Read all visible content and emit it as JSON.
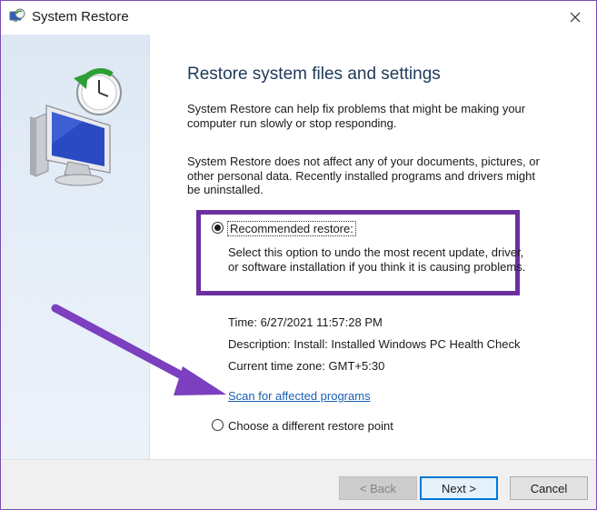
{
  "window": {
    "title": "System Restore"
  },
  "main": {
    "heading": "Restore system files and settings",
    "intro_1": "System Restore can help fix problems that might be making your computer run slowly or stop responding.",
    "intro_2": "System Restore does not affect any of your documents, pictures, or other personal data. Recently installed programs and drivers might be uninstalled.",
    "recommended": {
      "label": "Recommended restore:",
      "selected": true,
      "description": "Select this option to undo the most recent update, driver, or software installation if you think it is causing problems."
    },
    "details": {
      "time": "Time: 6/27/2021 11:57:28 PM",
      "description": "Description: Install: Installed Windows PC Health Check",
      "timezone": "Current time zone: GMT+5:30"
    },
    "scan_link": "Scan for affected programs",
    "alternative": {
      "label": "Choose a different restore point",
      "selected": false
    }
  },
  "footer": {
    "back_label": "< Back",
    "next_label": "Next >",
    "cancel_label": "Cancel"
  },
  "colors": {
    "highlight_border": "#6b2fa0",
    "annotation_arrow": "#7b3fbf",
    "link": "#1a5fb4"
  }
}
